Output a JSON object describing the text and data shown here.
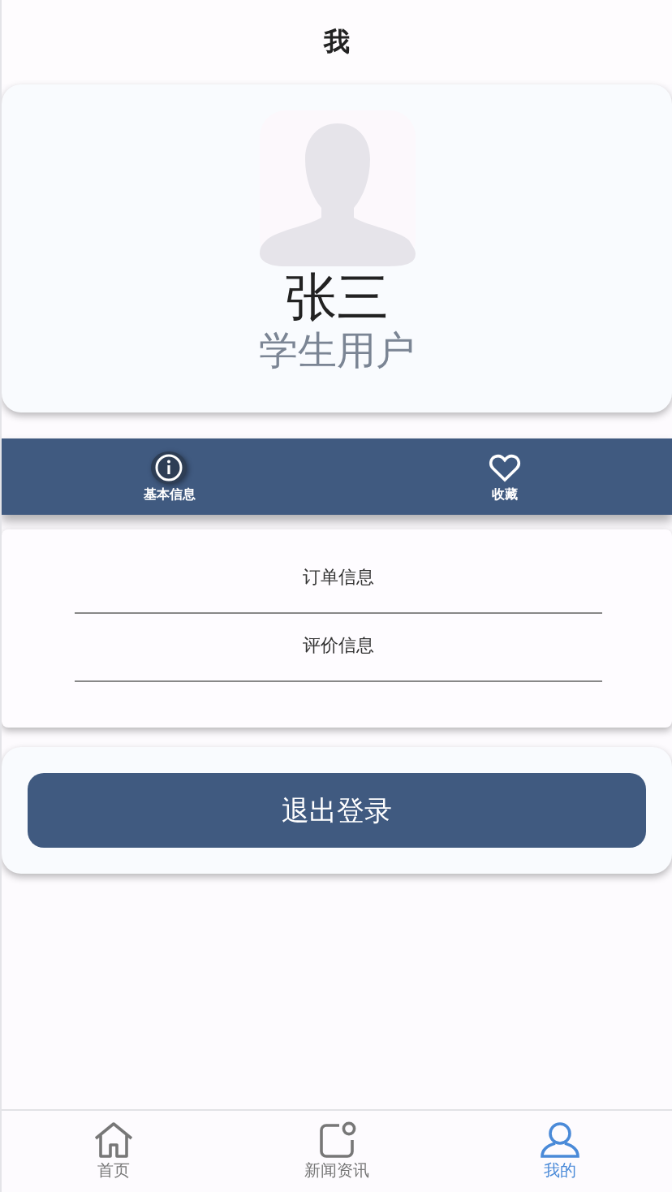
{
  "header": {
    "title": "我"
  },
  "profile": {
    "name": "张三",
    "role": "学生用户"
  },
  "tabs": [
    {
      "label": "基本信息",
      "kind": "info",
      "selected": true
    },
    {
      "label": "收藏",
      "kind": "heart",
      "selected": false
    }
  ],
  "menu": [
    "订单信息",
    "评价信息"
  ],
  "logout_button": "退出登录",
  "nav": [
    {
      "label": "首页",
      "kind": "home",
      "selected": false
    },
    {
      "label": "新闻资讯",
      "kind": "news",
      "selected": false
    },
    {
      "label": "我的",
      "kind": "user",
      "selected": true
    }
  ]
}
